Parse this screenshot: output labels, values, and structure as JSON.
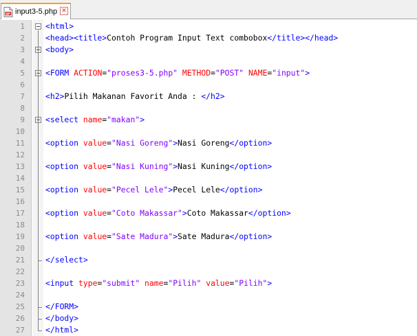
{
  "tab": {
    "filename": "input3-5.php",
    "close_glyph": "✕",
    "icon": "php-file-icon"
  },
  "colors": {
    "tag": "#0000ff",
    "attribute": "#ff0000",
    "value": "#8000ff",
    "text": "#000000",
    "active_tab_accent": "#fa9c2c",
    "line_number": "#8a8a8a",
    "gutter": "#e4e4e4"
  },
  "editor": {
    "lines": [
      {
        "n": "1",
        "tokens": [
          {
            "t": "tag",
            "s": "<html>"
          }
        ]
      },
      {
        "n": "2",
        "tokens": [
          {
            "t": "tag",
            "s": "<head><title>"
          },
          {
            "t": "text",
            "s": "Contoh Program Input Text combobox"
          },
          {
            "t": "tag",
            "s": "</title></head>"
          }
        ]
      },
      {
        "n": "3",
        "tokens": [
          {
            "t": "tag",
            "s": "<body>"
          }
        ]
      },
      {
        "n": "4",
        "tokens": []
      },
      {
        "n": "5",
        "tokens": [
          {
            "t": "tag",
            "s": "<FORM "
          },
          {
            "t": "attr",
            "s": "ACTION"
          },
          {
            "t": "text",
            "s": "="
          },
          {
            "t": "val",
            "s": "\"proses3-5.php\""
          },
          {
            "t": "text",
            "s": " "
          },
          {
            "t": "attr",
            "s": "METHOD"
          },
          {
            "t": "text",
            "s": "="
          },
          {
            "t": "val",
            "s": "\"POST\""
          },
          {
            "t": "text",
            "s": " "
          },
          {
            "t": "attr",
            "s": "NAME"
          },
          {
            "t": "text",
            "s": "="
          },
          {
            "t": "val",
            "s": "\"input\""
          },
          {
            "t": "tag",
            "s": ">"
          }
        ]
      },
      {
        "n": "6",
        "tokens": []
      },
      {
        "n": "7",
        "tokens": [
          {
            "t": "tag",
            "s": "<h2>"
          },
          {
            "t": "text",
            "s": "Pilih Makanan Favorit Anda : "
          },
          {
            "t": "tag",
            "s": "</h2>"
          }
        ]
      },
      {
        "n": "8",
        "tokens": []
      },
      {
        "n": "9",
        "tokens": [
          {
            "t": "tag",
            "s": "<select "
          },
          {
            "t": "attr",
            "s": "name"
          },
          {
            "t": "text",
            "s": "="
          },
          {
            "t": "val",
            "s": "\"makan\""
          },
          {
            "t": "tag",
            "s": ">"
          }
        ]
      },
      {
        "n": "10",
        "tokens": []
      },
      {
        "n": "11",
        "tokens": [
          {
            "t": "tag",
            "s": "<option "
          },
          {
            "t": "attr",
            "s": "value"
          },
          {
            "t": "text",
            "s": "="
          },
          {
            "t": "val",
            "s": "\"Nasi Goreng\""
          },
          {
            "t": "tag",
            "s": ">"
          },
          {
            "t": "text",
            "s": "Nasi Goreng"
          },
          {
            "t": "tag",
            "s": "</option>"
          }
        ]
      },
      {
        "n": "12",
        "tokens": []
      },
      {
        "n": "13",
        "tokens": [
          {
            "t": "tag",
            "s": "<option "
          },
          {
            "t": "attr",
            "s": "value"
          },
          {
            "t": "text",
            "s": "="
          },
          {
            "t": "val",
            "s": "\"Nasi Kuning\""
          },
          {
            "t": "tag",
            "s": ">"
          },
          {
            "t": "text",
            "s": "Nasi Kuning"
          },
          {
            "t": "tag",
            "s": "</option>"
          }
        ]
      },
      {
        "n": "14",
        "tokens": []
      },
      {
        "n": "15",
        "tokens": [
          {
            "t": "tag",
            "s": "<option "
          },
          {
            "t": "attr",
            "s": "value"
          },
          {
            "t": "text",
            "s": "="
          },
          {
            "t": "val",
            "s": "\"Pecel Lele\""
          },
          {
            "t": "tag",
            "s": ">"
          },
          {
            "t": "text",
            "s": "Pecel Lele"
          },
          {
            "t": "tag",
            "s": "</option>"
          }
        ]
      },
      {
        "n": "16",
        "tokens": []
      },
      {
        "n": "17",
        "tokens": [
          {
            "t": "tag",
            "s": "<option "
          },
          {
            "t": "attr",
            "s": "value"
          },
          {
            "t": "text",
            "s": "="
          },
          {
            "t": "val",
            "s": "\"Coto Makassar\""
          },
          {
            "t": "tag",
            "s": ">"
          },
          {
            "t": "text",
            "s": "Coto Makassar"
          },
          {
            "t": "tag",
            "s": "</option>"
          }
        ]
      },
      {
        "n": "18",
        "tokens": []
      },
      {
        "n": "19",
        "tokens": [
          {
            "t": "tag",
            "s": "<option "
          },
          {
            "t": "attr",
            "s": "value"
          },
          {
            "t": "text",
            "s": "="
          },
          {
            "t": "val",
            "s": "\"Sate Madura\""
          },
          {
            "t": "tag",
            "s": ">"
          },
          {
            "t": "text",
            "s": "Sate Madura"
          },
          {
            "t": "tag",
            "s": "</option>"
          }
        ]
      },
      {
        "n": "20",
        "tokens": []
      },
      {
        "n": "21",
        "tokens": [
          {
            "t": "tag",
            "s": "</select>"
          }
        ]
      },
      {
        "n": "22",
        "tokens": []
      },
      {
        "n": "23",
        "tokens": [
          {
            "t": "tag",
            "s": "<input "
          },
          {
            "t": "attr",
            "s": "type"
          },
          {
            "t": "text",
            "s": "="
          },
          {
            "t": "val",
            "s": "\"submit\""
          },
          {
            "t": "text",
            "s": " "
          },
          {
            "t": "attr",
            "s": "name"
          },
          {
            "t": "text",
            "s": "="
          },
          {
            "t": "val",
            "s": "\"Pilih\""
          },
          {
            "t": "text",
            "s": " "
          },
          {
            "t": "attr",
            "s": "value"
          },
          {
            "t": "text",
            "s": "="
          },
          {
            "t": "val",
            "s": "\"Pilih\""
          },
          {
            "t": "tag",
            "s": ">"
          }
        ]
      },
      {
        "n": "24",
        "tokens": []
      },
      {
        "n": "25",
        "tokens": [
          {
            "t": "tag",
            "s": "</FORM>"
          }
        ]
      },
      {
        "n": "26",
        "tokens": [
          {
            "t": "tag",
            "s": "</body>"
          }
        ]
      },
      {
        "n": "27",
        "tokens": [
          {
            "t": "tag",
            "s": "</html>"
          }
        ]
      }
    ]
  }
}
